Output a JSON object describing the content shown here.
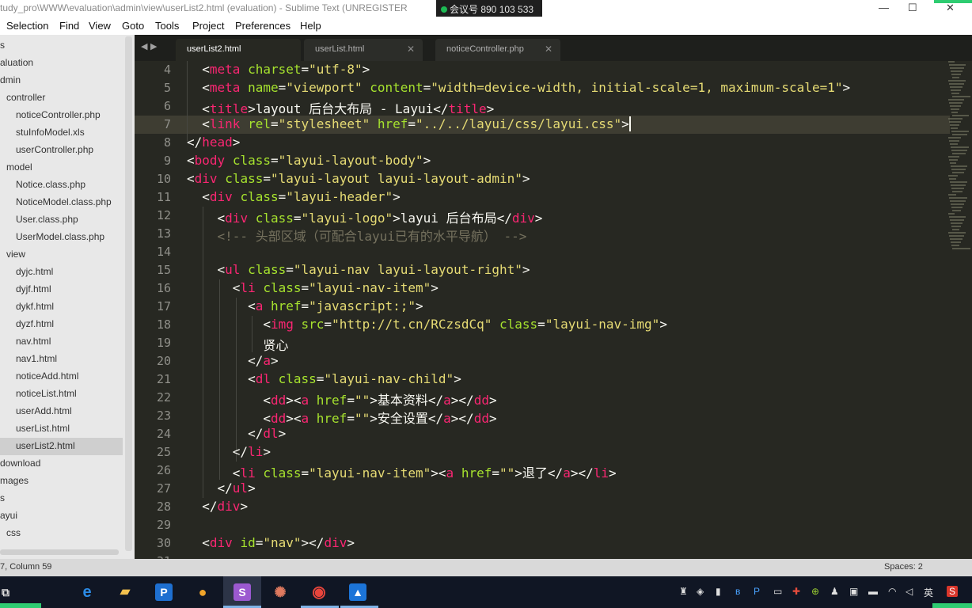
{
  "window": {
    "title": "tudy_pro\\WWW\\evaluation\\admin\\view\\userList2.html (evaluation) - Sublime Text (UNREGISTER",
    "meeting_badge": "会议号 890 103 533"
  },
  "menu": [
    "Selection",
    "Find",
    "View",
    "Goto",
    "Tools",
    "Project",
    "Preferences",
    "Help"
  ],
  "sidebar": {
    "items": [
      {
        "label": "s",
        "kind": "folder"
      },
      {
        "label": "aluation",
        "kind": "folder"
      },
      {
        "label": "dmin",
        "kind": "folder"
      },
      {
        "label": "controller",
        "kind": "folder"
      },
      {
        "label": "noticeController.php",
        "kind": "file"
      },
      {
        "label": "stuInfoModel.xls",
        "kind": "file"
      },
      {
        "label": "userController.php",
        "kind": "file"
      },
      {
        "label": "model",
        "kind": "folder"
      },
      {
        "label": "Notice.class.php",
        "kind": "file"
      },
      {
        "label": "NoticeModel.class.php",
        "kind": "file"
      },
      {
        "label": "User.class.php",
        "kind": "file"
      },
      {
        "label": "UserModel.class.php",
        "kind": "file"
      },
      {
        "label": "view",
        "kind": "folder"
      },
      {
        "label": "dyjc.html",
        "kind": "file"
      },
      {
        "label": "dyjf.html",
        "kind": "file"
      },
      {
        "label": "dykf.html",
        "kind": "file"
      },
      {
        "label": "dyzf.html",
        "kind": "file"
      },
      {
        "label": "nav.html",
        "kind": "file"
      },
      {
        "label": "nav1.html",
        "kind": "file"
      },
      {
        "label": "noticeAdd.html",
        "kind": "file"
      },
      {
        "label": "noticeList.html",
        "kind": "file"
      },
      {
        "label": "userAdd.html",
        "kind": "file"
      },
      {
        "label": "userList.html",
        "kind": "file"
      },
      {
        "label": "userList2.html",
        "kind": "file",
        "selected": true
      },
      {
        "label": "download",
        "kind": "folder"
      },
      {
        "label": "mages",
        "kind": "folder"
      },
      {
        "label": "s",
        "kind": "folder"
      },
      {
        "label": "ayui",
        "kind": "folder"
      },
      {
        "label": "css",
        "kind": "folder"
      }
    ]
  },
  "tabs": [
    {
      "label": "userList2.html",
      "active": true
    },
    {
      "label": "userList.html",
      "active": false
    },
    {
      "label": "noticeController.php",
      "active": false
    }
  ],
  "editor": {
    "current_line": 7,
    "lines": [
      {
        "n": "4",
        "tokens": [
          [
            "p",
            "  "
          ],
          [
            "p",
            "<"
          ],
          [
            "tag",
            "meta"
          ],
          [
            "p",
            " "
          ],
          [
            "attr",
            "charset"
          ],
          [
            "p",
            "="
          ],
          [
            "str",
            "\"utf-8\""
          ],
          [
            "p",
            ">"
          ]
        ]
      },
      {
        "n": "5",
        "tokens": [
          [
            "p",
            "  "
          ],
          [
            "p",
            "<"
          ],
          [
            "tag",
            "meta"
          ],
          [
            "p",
            " "
          ],
          [
            "attr",
            "name"
          ],
          [
            "p",
            "="
          ],
          [
            "str",
            "\"viewport\""
          ],
          [
            "p",
            " "
          ],
          [
            "attr",
            "content"
          ],
          [
            "p",
            "="
          ],
          [
            "str",
            "\"width=device-width, initial-scale=1, maximum-scale=1\""
          ],
          [
            "p",
            ">"
          ]
        ]
      },
      {
        "n": "6",
        "tokens": [
          [
            "p",
            "  "
          ],
          [
            "p",
            "<"
          ],
          [
            "tag",
            "title"
          ],
          [
            "p",
            ">"
          ],
          [
            "text",
            "layout 后台大布局 - Layui"
          ],
          [
            "p",
            "</"
          ],
          [
            "tag",
            "title"
          ],
          [
            "p",
            ">"
          ]
        ]
      },
      {
        "n": "7",
        "tokens": [
          [
            "p",
            "  "
          ],
          [
            "p",
            "<"
          ],
          [
            "tag",
            "link"
          ],
          [
            "p",
            " "
          ],
          [
            "attr",
            "rel"
          ],
          [
            "p",
            "="
          ],
          [
            "str",
            "\"stylesheet\""
          ],
          [
            "p",
            " "
          ],
          [
            "attr",
            "href"
          ],
          [
            "p",
            "="
          ],
          [
            "str",
            "\"../../layui/css/layui.css\""
          ],
          [
            "p",
            ">"
          ]
        ]
      },
      {
        "n": "8",
        "tokens": [
          [
            "p",
            "</"
          ],
          [
            "tag",
            "head"
          ],
          [
            "p",
            ">"
          ]
        ]
      },
      {
        "n": "9",
        "tokens": [
          [
            "p",
            "<"
          ],
          [
            "tag",
            "body"
          ],
          [
            "p",
            " "
          ],
          [
            "attr",
            "class"
          ],
          [
            "p",
            "="
          ],
          [
            "str",
            "\"layui-layout-body\""
          ],
          [
            "p",
            ">"
          ]
        ]
      },
      {
        "n": "10",
        "tokens": [
          [
            "p",
            "<"
          ],
          [
            "tag",
            "div"
          ],
          [
            "p",
            " "
          ],
          [
            "attr",
            "class"
          ],
          [
            "p",
            "="
          ],
          [
            "str",
            "\"layui-layout layui-layout-admin\""
          ],
          [
            "p",
            ">"
          ]
        ]
      },
      {
        "n": "11",
        "tokens": [
          [
            "p",
            "  "
          ],
          [
            "p",
            "<"
          ],
          [
            "tag",
            "div"
          ],
          [
            "p",
            " "
          ],
          [
            "attr",
            "class"
          ],
          [
            "p",
            "="
          ],
          [
            "str",
            "\"layui-header\""
          ],
          [
            "p",
            ">"
          ]
        ]
      },
      {
        "n": "12",
        "tokens": [
          [
            "p",
            "    "
          ],
          [
            "p",
            "<"
          ],
          [
            "tag",
            "div"
          ],
          [
            "p",
            " "
          ],
          [
            "attr",
            "class"
          ],
          [
            "p",
            "="
          ],
          [
            "str",
            "\"layui-logo\""
          ],
          [
            "p",
            ">"
          ],
          [
            "text",
            "layui 后台布局"
          ],
          [
            "p",
            "</"
          ],
          [
            "tag",
            "div"
          ],
          [
            "p",
            ">"
          ]
        ]
      },
      {
        "n": "13",
        "tokens": [
          [
            "p",
            "    "
          ],
          [
            "com",
            "<!-- 头部区域（可配合layui已有的水平导航） -->"
          ]
        ]
      },
      {
        "n": "14",
        "tokens": []
      },
      {
        "n": "15",
        "tokens": [
          [
            "p",
            "    "
          ],
          [
            "p",
            "<"
          ],
          [
            "tag",
            "ul"
          ],
          [
            "p",
            " "
          ],
          [
            "attr",
            "class"
          ],
          [
            "p",
            "="
          ],
          [
            "str",
            "\"layui-nav layui-layout-right\""
          ],
          [
            "p",
            ">"
          ]
        ]
      },
      {
        "n": "16",
        "tokens": [
          [
            "p",
            "      "
          ],
          [
            "p",
            "<"
          ],
          [
            "tag",
            "li"
          ],
          [
            "p",
            " "
          ],
          [
            "attr",
            "class"
          ],
          [
            "p",
            "="
          ],
          [
            "str",
            "\"layui-nav-item\""
          ],
          [
            "p",
            ">"
          ]
        ]
      },
      {
        "n": "17",
        "tokens": [
          [
            "p",
            "        "
          ],
          [
            "p",
            "<"
          ],
          [
            "tag",
            "a"
          ],
          [
            "p",
            " "
          ],
          [
            "attr",
            "href"
          ],
          [
            "p",
            "="
          ],
          [
            "str",
            "\"javascript:;\""
          ],
          [
            "p",
            ">"
          ]
        ]
      },
      {
        "n": "18",
        "tokens": [
          [
            "p",
            "          "
          ],
          [
            "p",
            "<"
          ],
          [
            "tag",
            "img"
          ],
          [
            "p",
            " "
          ],
          [
            "attr",
            "src"
          ],
          [
            "p",
            "="
          ],
          [
            "str",
            "\"http://t.cn/RCzsdCq\""
          ],
          [
            "p",
            " "
          ],
          [
            "attr",
            "class"
          ],
          [
            "p",
            "="
          ],
          [
            "str",
            "\"layui-nav-img\""
          ],
          [
            "p",
            ">"
          ]
        ]
      },
      {
        "n": "19",
        "tokens": [
          [
            "p",
            "          "
          ],
          [
            "text",
            "贤心"
          ]
        ]
      },
      {
        "n": "20",
        "tokens": [
          [
            "p",
            "        "
          ],
          [
            "p",
            "</"
          ],
          [
            "tag",
            "a"
          ],
          [
            "p",
            ">"
          ]
        ]
      },
      {
        "n": "21",
        "tokens": [
          [
            "p",
            "        "
          ],
          [
            "p",
            "<"
          ],
          [
            "tag",
            "dl"
          ],
          [
            "p",
            " "
          ],
          [
            "attr",
            "class"
          ],
          [
            "p",
            "="
          ],
          [
            "str",
            "\"layui-nav-child\""
          ],
          [
            "p",
            ">"
          ]
        ]
      },
      {
        "n": "22",
        "tokens": [
          [
            "p",
            "          "
          ],
          [
            "p",
            "<"
          ],
          [
            "tag",
            "dd"
          ],
          [
            "p",
            "><"
          ],
          [
            "tag",
            "a"
          ],
          [
            "p",
            " "
          ],
          [
            "attr",
            "href"
          ],
          [
            "p",
            "="
          ],
          [
            "str",
            "\"\""
          ],
          [
            "p",
            ">"
          ],
          [
            "text",
            "基本资料"
          ],
          [
            "p",
            "</"
          ],
          [
            "tag",
            "a"
          ],
          [
            "p",
            "></"
          ],
          [
            "tag",
            "dd"
          ],
          [
            "p",
            ">"
          ]
        ]
      },
      {
        "n": "23",
        "tokens": [
          [
            "p",
            "          "
          ],
          [
            "p",
            "<"
          ],
          [
            "tag",
            "dd"
          ],
          [
            "p",
            "><"
          ],
          [
            "tag",
            "a"
          ],
          [
            "p",
            " "
          ],
          [
            "attr",
            "href"
          ],
          [
            "p",
            "="
          ],
          [
            "str",
            "\"\""
          ],
          [
            "p",
            ">"
          ],
          [
            "text",
            "安全设置"
          ],
          [
            "p",
            "</"
          ],
          [
            "tag",
            "a"
          ],
          [
            "p",
            "></"
          ],
          [
            "tag",
            "dd"
          ],
          [
            "p",
            ">"
          ]
        ]
      },
      {
        "n": "24",
        "tokens": [
          [
            "p",
            "        "
          ],
          [
            "p",
            "</"
          ],
          [
            "tag",
            "dl"
          ],
          [
            "p",
            ">"
          ]
        ]
      },
      {
        "n": "25",
        "tokens": [
          [
            "p",
            "      "
          ],
          [
            "p",
            "</"
          ],
          [
            "tag",
            "li"
          ],
          [
            "p",
            ">"
          ]
        ]
      },
      {
        "n": "26",
        "tokens": [
          [
            "p",
            "      "
          ],
          [
            "p",
            "<"
          ],
          [
            "tag",
            "li"
          ],
          [
            "p",
            " "
          ],
          [
            "attr",
            "class"
          ],
          [
            "p",
            "="
          ],
          [
            "str",
            "\"layui-nav-item\""
          ],
          [
            "p",
            "><"
          ],
          [
            "tag",
            "a"
          ],
          [
            "p",
            " "
          ],
          [
            "attr",
            "href"
          ],
          [
            "p",
            "="
          ],
          [
            "str",
            "\"\""
          ],
          [
            "p",
            ">"
          ],
          [
            "text",
            "退了"
          ],
          [
            "p",
            "</"
          ],
          [
            "tag",
            "a"
          ],
          [
            "p",
            "></"
          ],
          [
            "tag",
            "li"
          ],
          [
            "p",
            ">"
          ]
        ]
      },
      {
        "n": "27",
        "tokens": [
          [
            "p",
            "    "
          ],
          [
            "p",
            "</"
          ],
          [
            "tag",
            "ul"
          ],
          [
            "p",
            ">"
          ]
        ]
      },
      {
        "n": "28",
        "tokens": [
          [
            "p",
            "  "
          ],
          [
            "p",
            "</"
          ],
          [
            "tag",
            "div"
          ],
          [
            "p",
            ">"
          ]
        ]
      },
      {
        "n": "29",
        "tokens": []
      },
      {
        "n": "30",
        "tokens": [
          [
            "p",
            "  "
          ],
          [
            "p",
            "<"
          ],
          [
            "tag",
            "div"
          ],
          [
            "p",
            " "
          ],
          [
            "attr",
            "id"
          ],
          [
            "p",
            "="
          ],
          [
            "str",
            "\"nav\""
          ],
          [
            "p",
            "></"
          ],
          [
            "tag",
            "div"
          ],
          [
            "p",
            ">"
          ]
        ]
      },
      {
        "n": "31",
        "tokens": []
      }
    ]
  },
  "statusbar": {
    "position": "7, Column 59",
    "indent": "Spaces: 2"
  },
  "taskbar": {
    "apps": [
      {
        "name": "task-view-icon",
        "glyph": "⧉"
      },
      {
        "name": "edge-icon",
        "glyph": "e"
      },
      {
        "name": "file-explorer-icon",
        "glyph": "▰"
      },
      {
        "name": "app-p-icon",
        "glyph": "P"
      },
      {
        "name": "weasel-icon",
        "glyph": "●"
      },
      {
        "name": "sublime-text-icon",
        "glyph": "S"
      },
      {
        "name": "color-app-icon",
        "glyph": "✺"
      },
      {
        "name": "chrome-icon",
        "glyph": "◉"
      },
      {
        "name": "meeting-app-icon",
        "glyph": "▲"
      }
    ],
    "tray_lang": "英"
  },
  "colors": {
    "editor_bg": "#272822",
    "tag": "#f92672",
    "attr": "#a6e22e",
    "string": "#e6db74",
    "comment": "#75715e",
    "sidebar_bg": "#e8e8e8",
    "taskbar_bg": "#101624"
  }
}
